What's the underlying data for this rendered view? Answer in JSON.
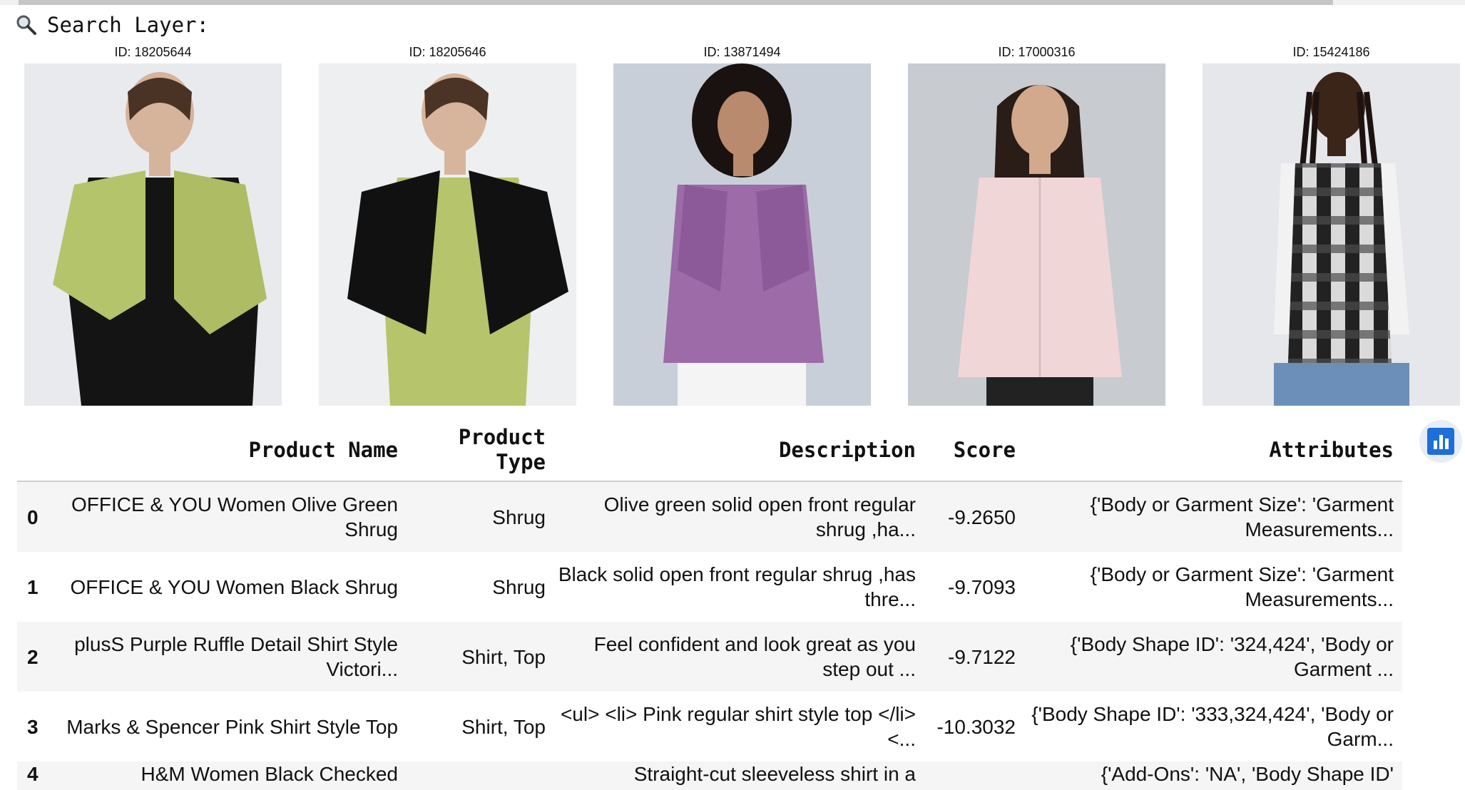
{
  "search": {
    "label": "Search Layer:",
    "icon": "magnifier-icon"
  },
  "results": [
    {
      "id_label": "ID: 18205644",
      "bg": "#e9eaee"
    },
    {
      "id_label": "ID: 18205646",
      "bg": "#eeeff1"
    },
    {
      "id_label": "ID: 13871494",
      "bg": "#c9cfd9"
    },
    {
      "id_label": "ID: 17000316",
      "bg": "#c8cbd0"
    },
    {
      "id_label": "ID: 15424186",
      "bg": "#e6e7ea"
    }
  ],
  "table": {
    "headers": [
      "",
      "Product Name",
      "Product Type",
      "Description",
      "Score",
      "Attributes"
    ],
    "rows": [
      {
        "index": "0",
        "name": "OFFICE & YOU Women Olive Green Shrug",
        "type": "Shrug",
        "description": "Olive green solid open front regular shrug ,ha...",
        "score": "-9.2650",
        "attributes": "{'Body or Garment Size': 'Garment Measurements..."
      },
      {
        "index": "1",
        "name": "OFFICE & YOU Women Black Shrug",
        "type": "Shrug",
        "description": "Black solid open front regular shrug ,has thre...",
        "score": "-9.7093",
        "attributes": "{'Body or Garment Size': 'Garment Measurements..."
      },
      {
        "index": "2",
        "name": "plusS Purple Ruffle Detail Shirt Style Victori...",
        "type": "Shirt, Top",
        "description": "Feel confident and look great as you step out ...",
        "score": "-9.7122",
        "attributes": "{'Body Shape ID': '324,424', 'Body or Garment ..."
      },
      {
        "index": "3",
        "name": "Marks & Spencer Pink Shirt Style Top",
        "type": "Shirt, Top",
        "description": "<ul> <li> Pink regular shirt style top </li> <...",
        "score": "-10.3032",
        "attributes": "{'Body Shape ID': '333,324,424', 'Body or Garm..."
      },
      {
        "index": "4",
        "name": "H&M Women Black Checked",
        "type": "",
        "description": "Straight-cut sleeveless shirt in a",
        "score": "",
        "attributes": "{'Add-Ons': 'NA', 'Body Shape ID'"
      }
    ]
  },
  "toolbar": {
    "chart_button_icon": "bar-chart-icon",
    "accent": "#1e6fd9"
  }
}
